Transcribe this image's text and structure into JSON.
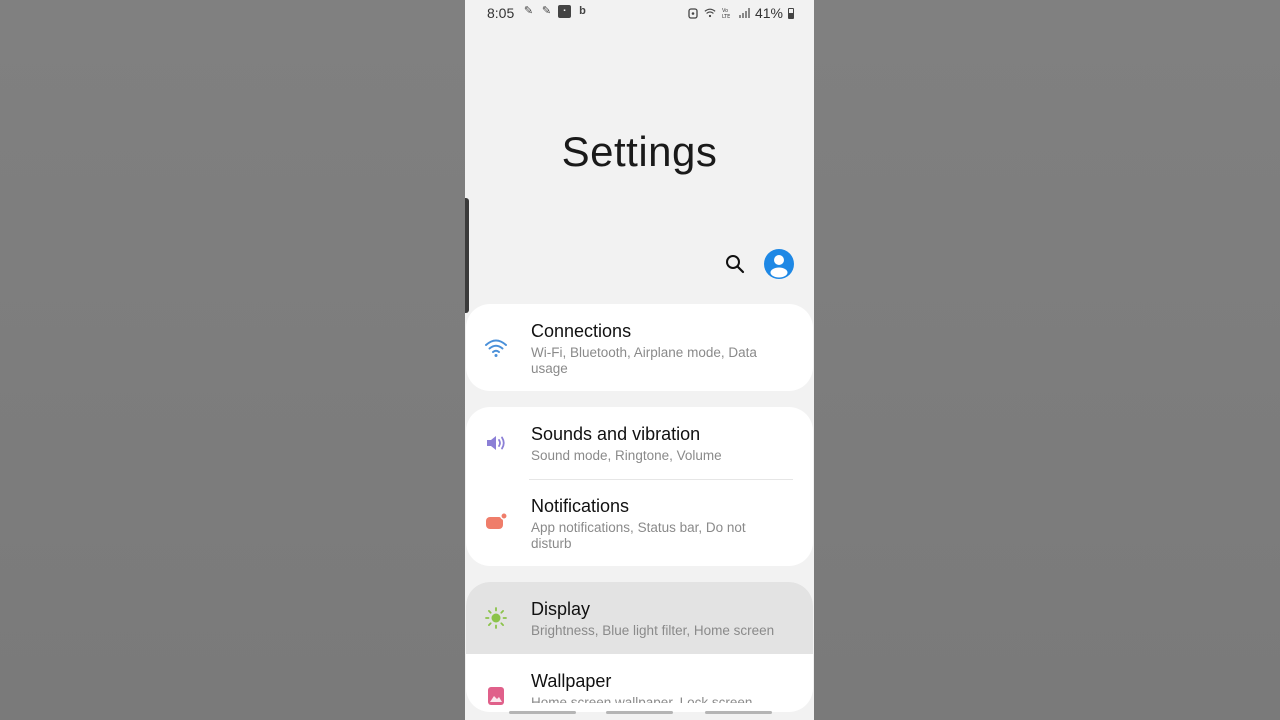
{
  "status_bar": {
    "time": "8:05",
    "battery_percent": "41%",
    "notification_icons": [
      "feather-icon",
      "feather-icon",
      "app-box-icon",
      "bb-icon"
    ],
    "system_icons": [
      "alarm-icon",
      "wifi-icon",
      "volte-icon",
      "signal-icon"
    ]
  },
  "page_title": "Settings",
  "toolbar": {
    "search_icon": "search-icon",
    "account_icon": "account-icon",
    "account_color": "#1e88e5"
  },
  "settings": [
    {
      "title": "Connections",
      "subtitle": "Wi-Fi, Bluetooth, Airplane mode, Data usage",
      "icon": "wifi-icon",
      "icon_color": "#4a90d9"
    },
    {
      "title": "Sounds and vibration",
      "subtitle": "Sound mode, Ringtone, Volume",
      "icon": "speaker-icon",
      "icon_color": "#8b7fd6"
    },
    {
      "title": "Notifications",
      "subtitle": "App notifications, Status bar, Do not disturb",
      "icon": "notification-icon",
      "icon_color": "#ef7d6a"
    },
    {
      "title": "Display",
      "subtitle": "Brightness, Blue light filter, Home screen",
      "icon": "sun-icon",
      "icon_color": "#8bc34a"
    },
    {
      "title": "Wallpaper",
      "subtitle": "Home screen wallpaper, Lock screen",
      "icon": "wallpaper-icon",
      "icon_color": "#e0608a"
    }
  ]
}
